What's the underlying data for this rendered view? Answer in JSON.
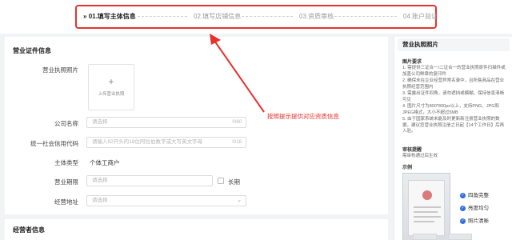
{
  "steps": [
    {
      "label": "01.填写主体信息",
      "prefix": "»",
      "active": true
    },
    {
      "label": "02.填写店铺信息",
      "active": false
    },
    {
      "label": "03.资质审核",
      "active": false
    },
    {
      "label": "04.账户验证",
      "active": false
    }
  ],
  "form": {
    "section_title": "营业证件信息",
    "license_photo_label": "营业执照照片",
    "upload_plus": "+",
    "upload_text": "上传营业执照",
    "company_name_label": "公司名称",
    "company_name_placeholder": "请选择",
    "company_name_counter": "0/60",
    "credit_code_label": "统一社会信用代码",
    "credit_code_placeholder": "请输入92开头的18位阿拉伯数字或大写英文字母",
    "credit_code_counter": "0/18",
    "entity_type_label": "主体类型",
    "entity_type_value": "个体工商户",
    "period_label": "营业期限",
    "period_placeholder": "请选择",
    "long_term_label": "长期",
    "address_label": "经营地址",
    "address_placeholder": "请选择",
    "operator_section_title": "经营者信息"
  },
  "annotation": {
    "text": "按照提示提供对应资质信息",
    "color": "#e5322d"
  },
  "side": {
    "title": "营业执照照片",
    "requirements_title": "图片要求",
    "requirements": [
      "1. 需提供三证合一/二证合一的营业执照原件扫描件或加盖公司鲜章的复印件",
      "2. 确保未在企业经营异常名录中，且所售商品在营业执照经营范围内",
      "3. 需露出证件四角，请勿遮挡或模糊，保持信息清晰可见",
      "4. 图片尺寸为800*800px以上，支持PNG、JPG和JPEG格式，大小不超过5MB",
      "5. 由于国家系统未能及时更新新注册营业执照的数据，建议您营业执照注册之日起【14个工作日】后再入驻。"
    ],
    "review_title": "审核提醒",
    "review_text": "需审核通过后生效",
    "sample_title": "示例",
    "checks": [
      "四角完整",
      "亮度均匀",
      "照片清晰"
    ]
  },
  "colors": {
    "accent_red": "#e5322d",
    "check_blue": "#2f6ee0"
  }
}
